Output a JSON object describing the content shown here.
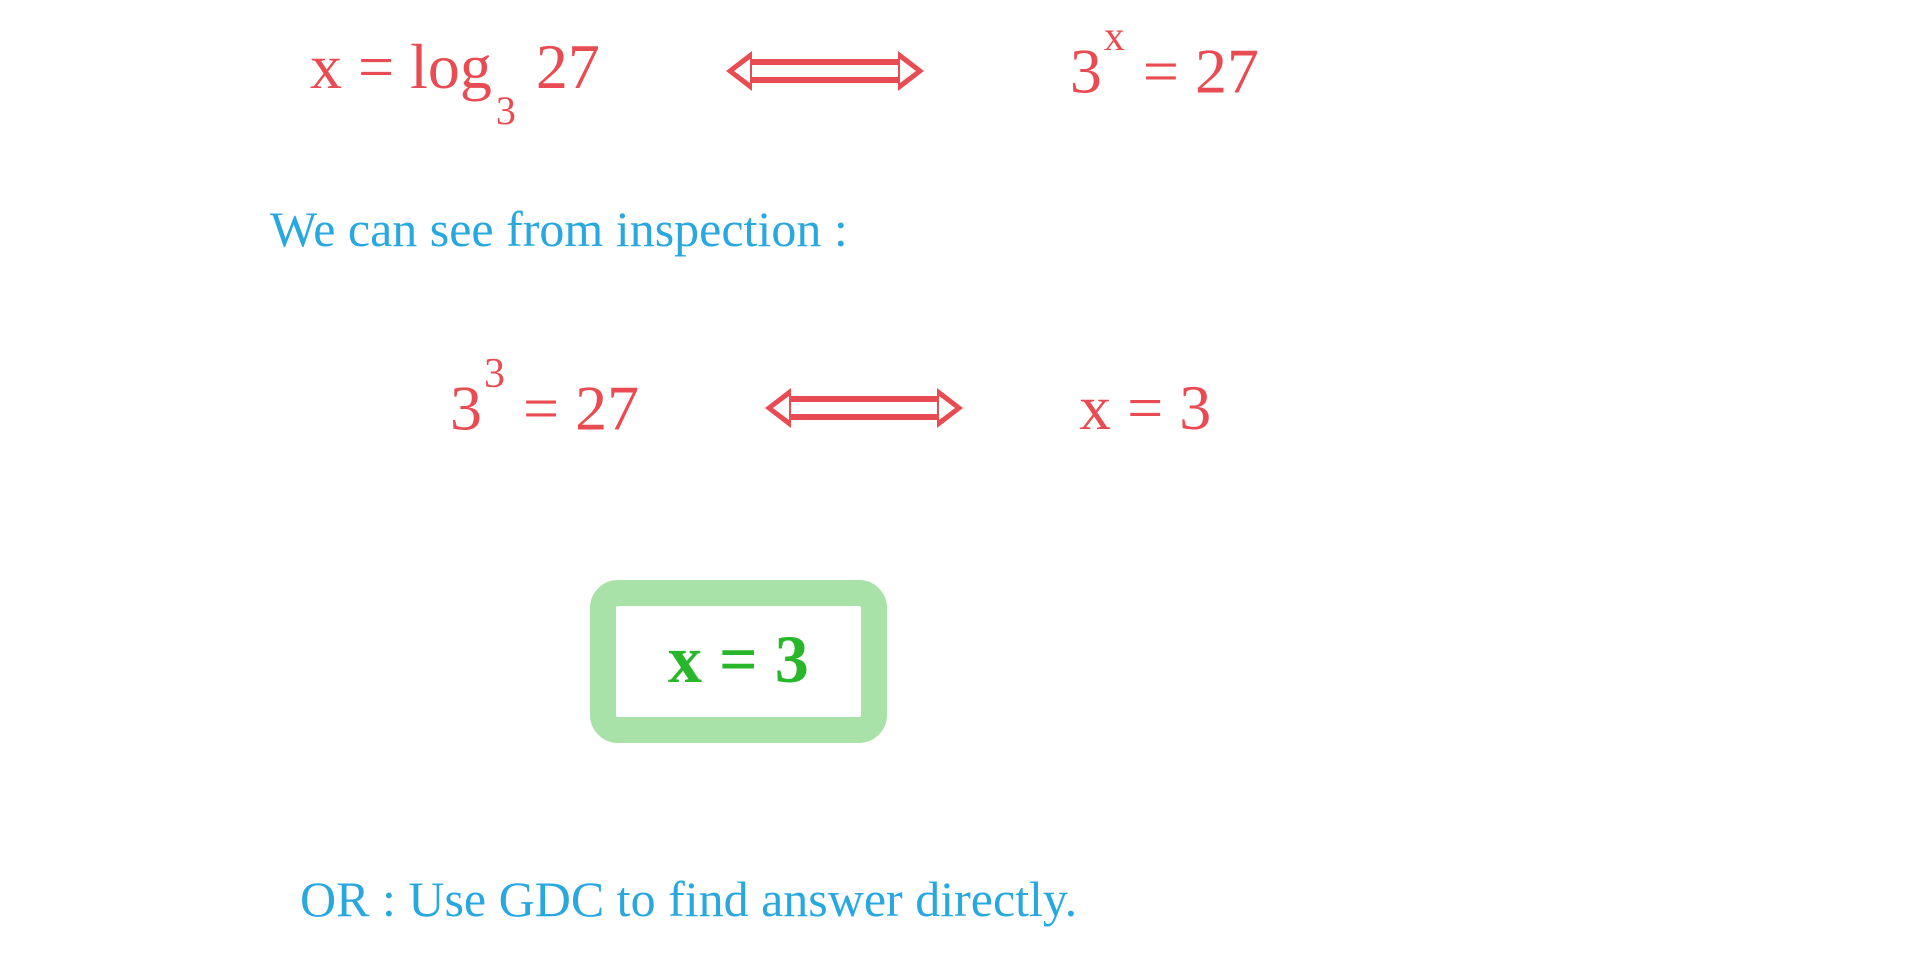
{
  "line1": {
    "left": "x  =  log",
    "base": "3",
    "arg": " 27",
    "right_base": "3",
    "right_exp": "x",
    "right_rest": "  =  27"
  },
  "line2": "We  can  see  from   inspection :",
  "line3": {
    "left_base": "3",
    "left_exp": "3",
    "left_rest": "  =  27",
    "right": "x  =  3"
  },
  "answer": "x  =  3",
  "line5": "OR :  Use  GDC   to  find   answer  directly."
}
